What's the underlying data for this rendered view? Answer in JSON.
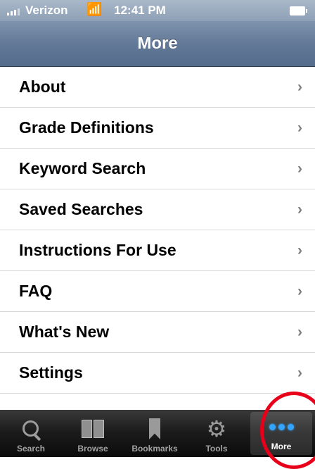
{
  "status_bar": {
    "carrier": "Verizon",
    "time": "12:41 PM",
    "signal_icon": "signal-bars-icon",
    "wifi_icon": "wifi-icon",
    "battery_icon": "battery-icon"
  },
  "nav": {
    "title": "More"
  },
  "menu": {
    "items": [
      {
        "label": "About",
        "chevron": "›"
      },
      {
        "label": "Grade Definitions",
        "chevron": "›"
      },
      {
        "label": "Keyword Search",
        "chevron": "›"
      },
      {
        "label": "Saved Searches",
        "chevron": "›"
      },
      {
        "label": "Instructions For Use",
        "chevron": "›"
      },
      {
        "label": "FAQ",
        "chevron": "›"
      },
      {
        "label": "What's New",
        "chevron": "›"
      },
      {
        "label": "Settings",
        "chevron": "›"
      },
      {
        "label": "",
        "chevron": ""
      }
    ]
  },
  "tab_bar": {
    "tabs": [
      {
        "label": "Search",
        "icon": "magnifier-icon"
      },
      {
        "label": "Browse",
        "icon": "book-icon"
      },
      {
        "label": "Bookmarks",
        "icon": "bookmark-icon"
      },
      {
        "label": "Tools",
        "icon": "gear-icon"
      },
      {
        "label": "More",
        "icon": "more-dots-icon",
        "active": true
      }
    ]
  },
  "colors": {
    "nav_bar": "#627997",
    "tab_active_icon": "#33a4ff",
    "annotation_circle": "#e8001b"
  }
}
